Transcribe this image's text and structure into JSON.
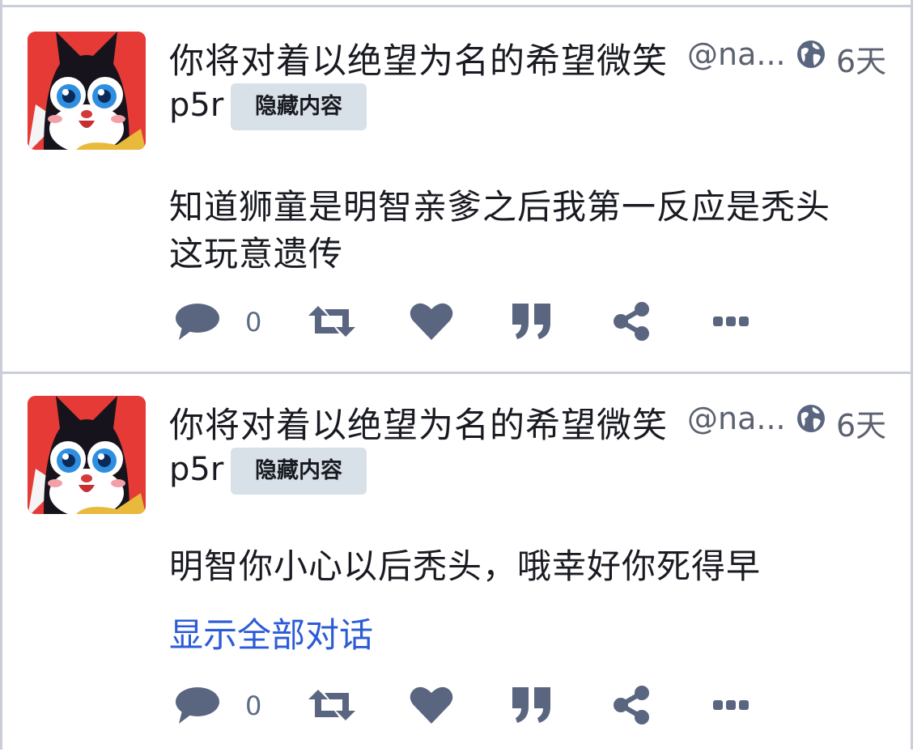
{
  "posts": [
    {
      "display_name": "你将对着以绝望为名的希望微笑",
      "handle": "@na...",
      "visibility_icon": "globe-icon",
      "time": "6天",
      "instance": "p5r",
      "cw_label": "隐藏内容",
      "content_lines": [
        "知道狮童是明智亲爹之后我第一反应是秃头",
        "这玩意遗传"
      ],
      "thread_link": "",
      "reply_count": "0",
      "actions": [
        "reply-icon",
        "boost-icon",
        "favourite-icon",
        "quote-icon",
        "share-icon",
        "more-icon"
      ]
    },
    {
      "display_name": "你将对着以绝望为名的希望微笑",
      "handle": "@na...",
      "visibility_icon": "globe-icon",
      "time": "6天",
      "instance": "p5r",
      "cw_label": "隐藏内容",
      "content_lines": [
        "明智你小心以后秃头，哦幸好你死得早"
      ],
      "thread_link": "显示全部对话",
      "reply_count": "0",
      "actions": [
        "reply-icon",
        "boost-icon",
        "favourite-icon",
        "quote-icon",
        "share-icon",
        "more-icon"
      ]
    }
  ],
  "colors": {
    "link": "#2b5bd7",
    "icon": "#5a6580",
    "badge_bg": "#d9e1e8",
    "avatar_bg": "#e53a35"
  }
}
